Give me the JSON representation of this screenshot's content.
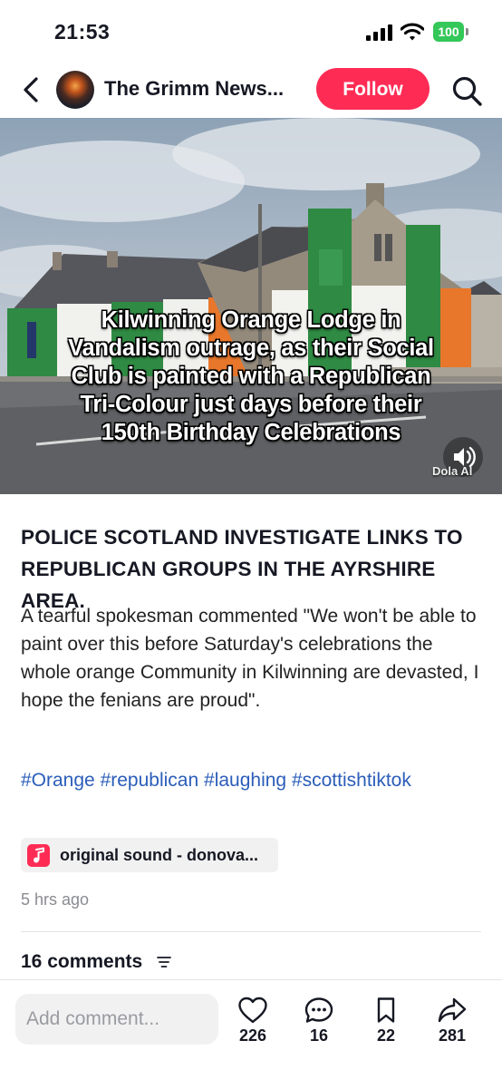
{
  "status_bar": {
    "time": "21:53",
    "battery": "100"
  },
  "header": {
    "channel_name": "The Grimm News...",
    "follow_label": "Follow"
  },
  "media": {
    "caption_lines": [
      "Kilwinning Orange Lodge in",
      "Vandalism outrage, as their Social",
      "Club is painted with a Republican",
      "Tri-Colour just days before their",
      "150th Birthday Celebrations"
    ],
    "watermark": "Dola AI"
  },
  "post": {
    "headline": "POLICE SCOTLAND INVESTIGATE LINKS TO REPUBLICAN GROUPS IN THE AYRSHIRE AREA.",
    "body": "A tearful spokesman commented \"We won't be able to paint over this before Saturday's celebrations the whole orange Community in Kilwinning are devasted, I hope the fenians are proud\".",
    "hashtags": [
      "#Orange",
      "#republican",
      "#laughing",
      "#scottishtiktok"
    ],
    "sound_label": "original sound - donova...",
    "timestamp": "5 hrs ago",
    "comments_heading": "16 comments"
  },
  "bottom_bar": {
    "comment_placeholder": "Add comment...",
    "likes": "226",
    "comments": "16",
    "saves": "22",
    "shares": "281"
  },
  "colors": {
    "accent": "#fe2c55",
    "hashtag": "#2b5db9",
    "battery": "#34c759"
  },
  "icons": [
    "back-chevron-icon",
    "search-icon",
    "speaker-icon",
    "music-note-icon",
    "sort-icon",
    "heart-icon",
    "comment-icon",
    "bookmark-icon",
    "share-icon"
  ]
}
